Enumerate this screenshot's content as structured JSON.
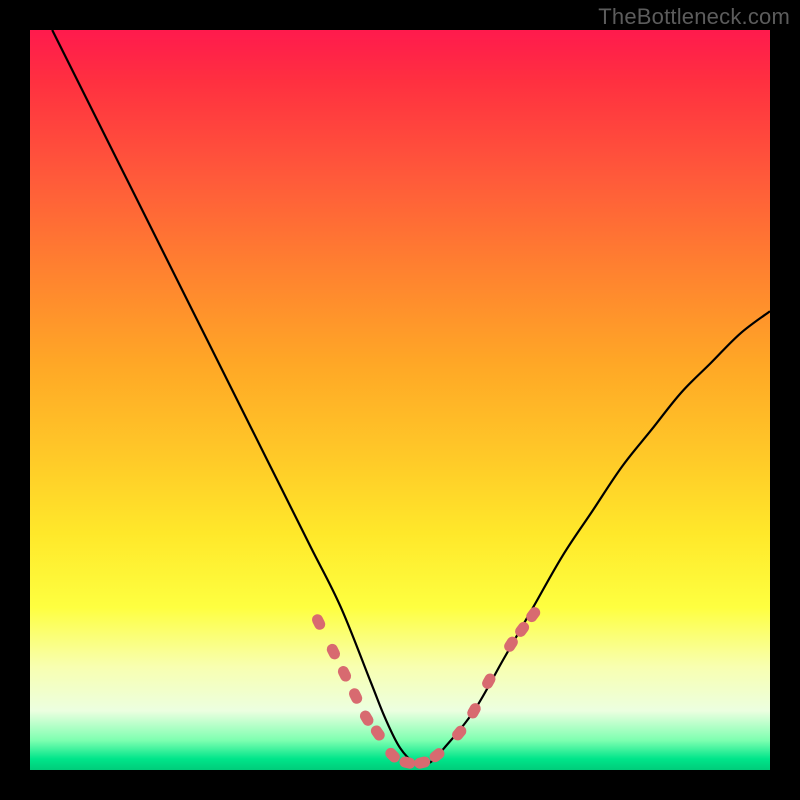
{
  "watermark": "TheBottleneck.com",
  "chart_data": {
    "type": "line",
    "title": "",
    "xlabel": "",
    "ylabel": "",
    "xlim": [
      0,
      100
    ],
    "ylim": [
      0,
      100
    ],
    "series": [
      {
        "name": "bottleneck-curve",
        "x": [
          3,
          6,
          10,
          14,
          18,
          22,
          26,
          30,
          34,
          38,
          42,
          46,
          48,
          50,
          52,
          54,
          56,
          60,
          64,
          68,
          72,
          76,
          80,
          84,
          88,
          92,
          96,
          100
        ],
        "y": [
          100,
          94,
          86,
          78,
          70,
          62,
          54,
          46,
          38,
          30,
          22,
          12,
          7,
          3,
          1,
          1,
          3,
          8,
          15,
          22,
          29,
          35,
          41,
          46,
          51,
          55,
          59,
          62
        ]
      }
    ],
    "markers": {
      "name": "sample-points",
      "points": [
        {
          "x": 39,
          "y": 20
        },
        {
          "x": 41,
          "y": 16
        },
        {
          "x": 42.5,
          "y": 13
        },
        {
          "x": 44,
          "y": 10
        },
        {
          "x": 45.5,
          "y": 7
        },
        {
          "x": 47,
          "y": 5
        },
        {
          "x": 49,
          "y": 2
        },
        {
          "x": 51,
          "y": 1
        },
        {
          "x": 53,
          "y": 1
        },
        {
          "x": 55,
          "y": 2
        },
        {
          "x": 58,
          "y": 5
        },
        {
          "x": 60,
          "y": 8
        },
        {
          "x": 62,
          "y": 12
        },
        {
          "x": 65,
          "y": 17
        },
        {
          "x": 66.5,
          "y": 19
        },
        {
          "x": 68,
          "y": 21
        }
      ]
    },
    "gradient_stops": [
      {
        "pos": 0,
        "color": "#ff1a4d"
      },
      {
        "pos": 50,
        "color": "#ffb300"
      },
      {
        "pos": 80,
        "color": "#feff40"
      },
      {
        "pos": 100,
        "color": "#00cc7a"
      }
    ]
  }
}
